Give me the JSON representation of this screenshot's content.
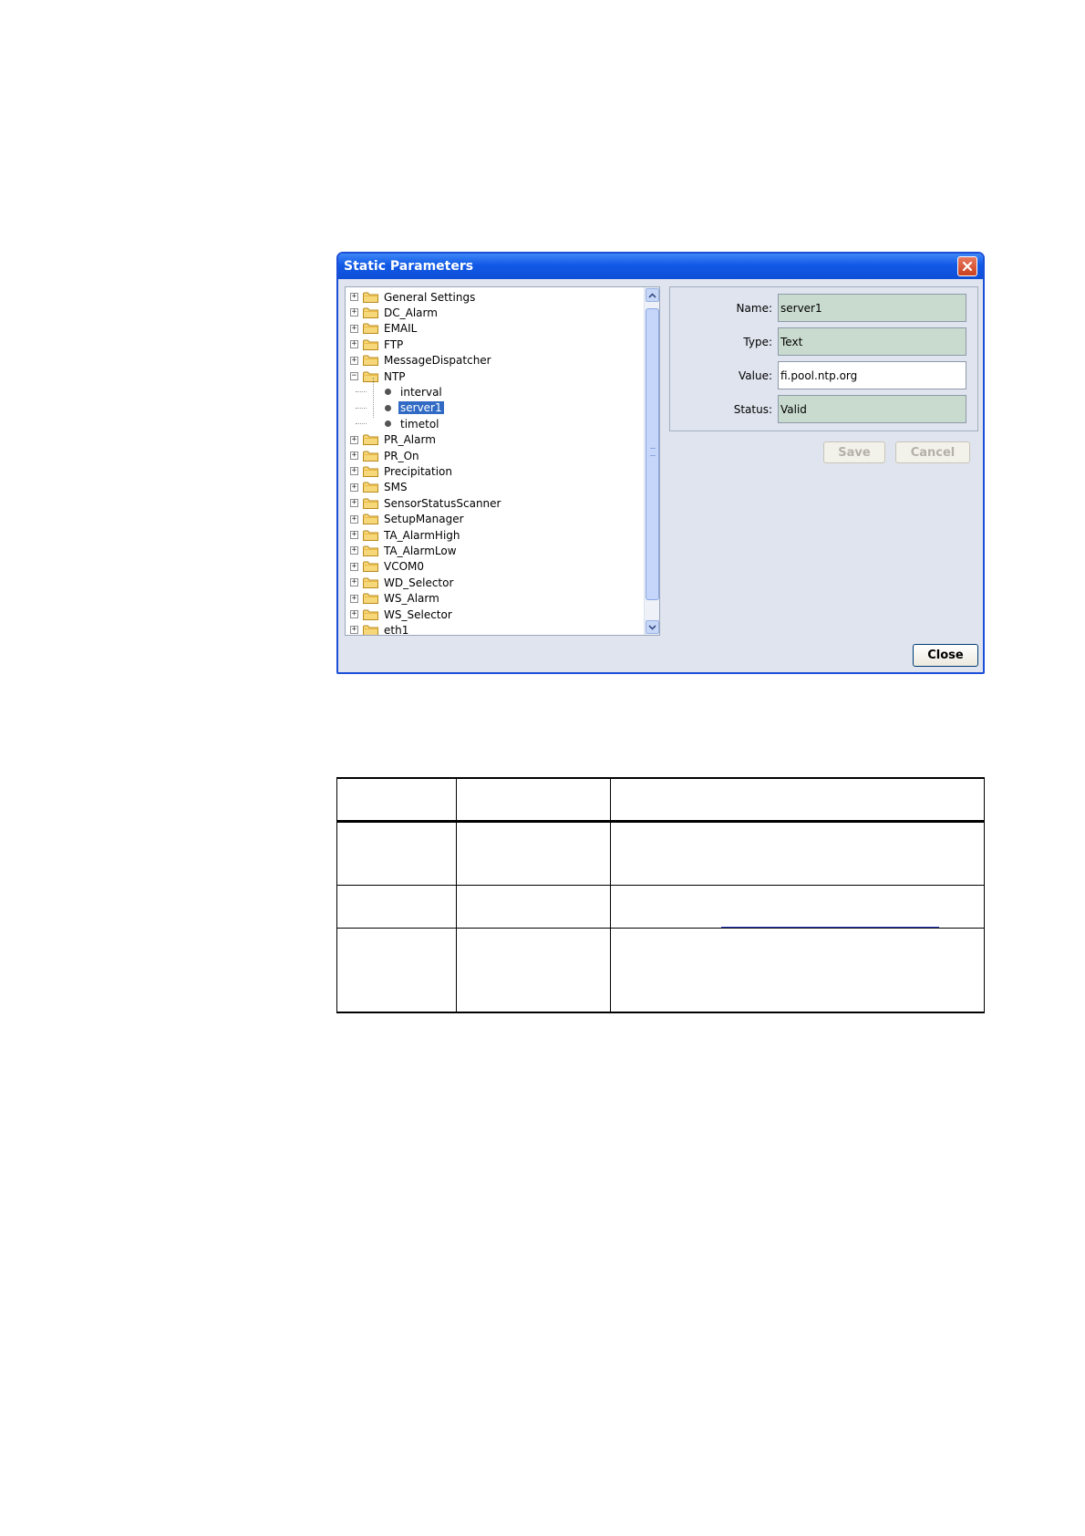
{
  "dialog": {
    "title": "Static Parameters",
    "close_button_label": "Close",
    "save_label": "Save",
    "cancel_label": "Cancel"
  },
  "tree": {
    "items": [
      {
        "label": "General Settings",
        "type": "folder",
        "expanded": false
      },
      {
        "label": "DC_Alarm",
        "type": "folder",
        "expanded": false
      },
      {
        "label": "EMAIL",
        "type": "folder",
        "expanded": false
      },
      {
        "label": "FTP",
        "type": "folder",
        "expanded": false
      },
      {
        "label": "MessageDispatcher",
        "type": "folder",
        "expanded": false
      },
      {
        "label": "NTP",
        "type": "folder",
        "expanded": true
      },
      {
        "label": "interval",
        "type": "leaf"
      },
      {
        "label": "server1",
        "type": "leaf",
        "selected": true
      },
      {
        "label": "timetol",
        "type": "leaf"
      },
      {
        "label": "PR_Alarm",
        "type": "folder",
        "expanded": false
      },
      {
        "label": "PR_On",
        "type": "folder",
        "expanded": false
      },
      {
        "label": "Precipitation",
        "type": "folder",
        "expanded": false
      },
      {
        "label": "SMS",
        "type": "folder",
        "expanded": false
      },
      {
        "label": "SensorStatusScanner",
        "type": "folder",
        "expanded": false
      },
      {
        "label": "SetupManager",
        "type": "folder",
        "expanded": false
      },
      {
        "label": "TA_AlarmHigh",
        "type": "folder",
        "expanded": false
      },
      {
        "label": "TA_AlarmLow",
        "type": "folder",
        "expanded": false
      },
      {
        "label": "VCOM0",
        "type": "folder",
        "expanded": false
      },
      {
        "label": "WD_Selector",
        "type": "folder",
        "expanded": false
      },
      {
        "label": "WS_Alarm",
        "type": "folder",
        "expanded": false
      },
      {
        "label": "WS_Selector",
        "type": "folder",
        "expanded": false
      },
      {
        "label": "eth1",
        "type": "folder",
        "expanded": false
      }
    ]
  },
  "properties": {
    "name_label": "Name:",
    "name_value": "server1",
    "type_label": "Type:",
    "type_value": "Text",
    "value_label": "Value:",
    "value_value": "fi.pool.ntp.org",
    "status_label": "Status:",
    "status_value": "Valid"
  },
  "colors": {
    "titlebar": "#0e4fd6",
    "dialog_bg": "#dfe4ee",
    "readonly_field": "#c9dbcf",
    "selection": "#316ac5"
  },
  "icons": {
    "close": "close-x-icon",
    "folder": "folder-icon",
    "leaf": "bullet-icon",
    "scroll_up": "chevron-up-icon",
    "scroll_down": "chevron-down-icon"
  }
}
